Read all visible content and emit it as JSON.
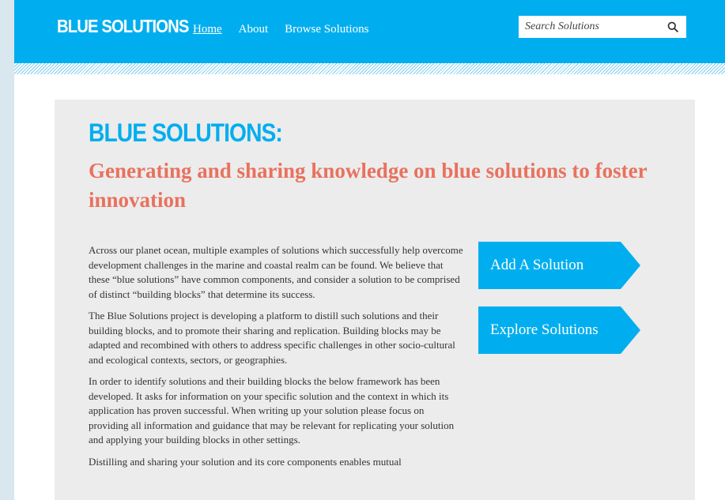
{
  "header": {
    "logo": "BLUE SOLUTIONS",
    "nav": [
      {
        "label": "Home",
        "active": true
      },
      {
        "label": "About",
        "active": false
      },
      {
        "label": "Browse Solutions",
        "active": false
      }
    ],
    "search": {
      "placeholder": "Search Solutions",
      "value": "",
      "icon": "search-icon"
    }
  },
  "hero": {
    "title": "BLUE SOLUTIONS:",
    "subtitle": "Generating and sharing knowledge on blue solutions to foster innovation"
  },
  "body": {
    "paragraphs": [
      "Across our planet ocean, multiple examples of solutions which successfully help overcome development challenges in the marine and coastal realm can be found. We believe that these “blue solutions” have common components, and consider a solution to be comprised of distinct “building blocks” that determine its success.",
      "The Blue Solutions project is developing a platform to distill such solutions and their building blocks, and to promote their sharing and replication. Building blocks may be adapted and recombined with others to address specific challenges in other socio-cultural and ecological contexts, sectors, or geographies.",
      "In order to identify solutions and their building blocks the below framework has been developed. It asks for information on your specific solution and the context in which its application has proven successful. When writing up your solution please focus on providing all information and guidance that may be relevant for replicating your solution and applying your building blocks in other settings.",
      "Distilling and sharing your solution and its core components enables mutual"
    ]
  },
  "actions": {
    "add_solution": "Add A Solution",
    "explore_solutions": "Explore Solutions"
  },
  "colors": {
    "brand_blue": "#00aeef",
    "accent_coral": "#e8725e",
    "panel_gray": "#ececec",
    "text": "#333333"
  }
}
